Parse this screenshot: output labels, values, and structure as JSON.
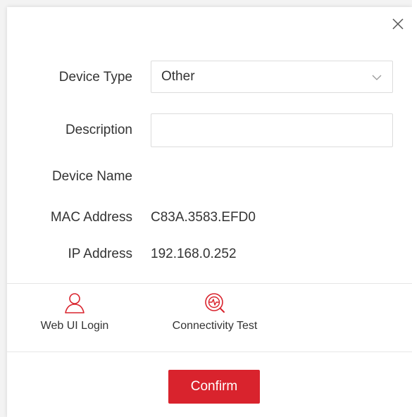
{
  "dialog": {
    "close_icon": "close-icon"
  },
  "form": {
    "device_type": {
      "label": "Device Type",
      "selected": "Other",
      "caret_icon": "chevron-down-icon"
    },
    "description": {
      "label": "Description",
      "value": "",
      "placeholder": ""
    },
    "device_name": {
      "label": "Device Name",
      "value": ""
    },
    "mac_address": {
      "label": "MAC Address",
      "value": "C83A.3583.EFD0"
    },
    "ip_address": {
      "label": "IP Address",
      "value": "192.168.0.252"
    }
  },
  "actions": [
    {
      "label": "Web UI Login",
      "icon": "user-icon"
    },
    {
      "label": "Connectivity Test",
      "icon": "connectivity-test-icon"
    }
  ],
  "footer": {
    "confirm_label": "Confirm"
  },
  "colors": {
    "accent": "#d9232d",
    "text": "#333333",
    "border": "#dcdcdc",
    "divider": "#e6e6e6"
  }
}
